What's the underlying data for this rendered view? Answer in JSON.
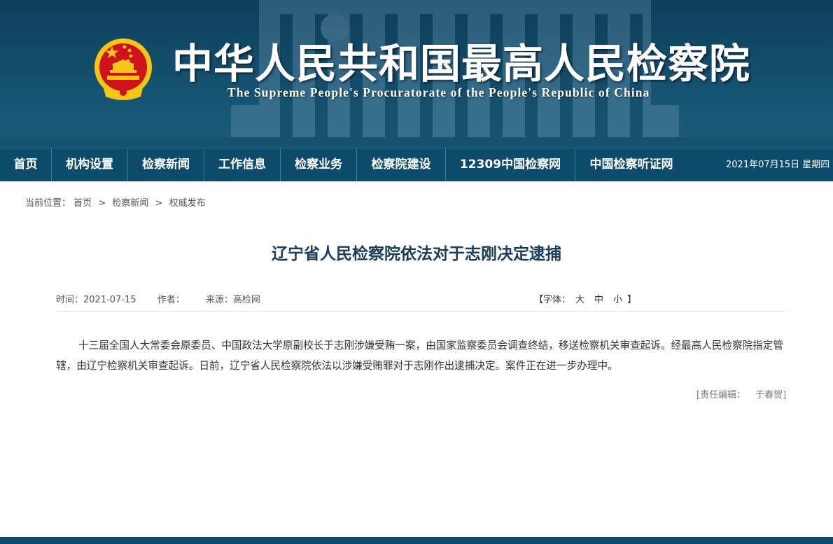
{
  "header": {
    "title_cn": "中华人民共和国最高人民检察院",
    "title_en": "The Supreme People's Procuratorate of the People's Republic of China",
    "emblem_icon": "national-emblem-icon",
    "colors": {
      "banner": "#124a68",
      "nav": "#0d4a6b",
      "emblem_red": "#d0121b",
      "emblem_gold": "#f5c518"
    }
  },
  "nav": {
    "items": [
      {
        "label": "首页"
      },
      {
        "label": "机构设置"
      },
      {
        "label": "检察新闻"
      },
      {
        "label": "工作信息"
      },
      {
        "label": "检察业务"
      },
      {
        "label": "检察院建设"
      },
      {
        "label": "12309中国检察网"
      },
      {
        "label": "中国检察听证网"
      }
    ],
    "date": "2021年07月15日  星期四"
  },
  "breadcrumb": {
    "prefix": "当前位置：",
    "items": [
      "首页",
      "检察新闻",
      "权威发布"
    ],
    "separator": ">"
  },
  "article": {
    "title": "辽宁省人民检察院依法对于志刚决定逮捕",
    "time": "时间：2021-07-15",
    "author": "作者：",
    "source": "来源：高检网",
    "font_size": {
      "open": "【字体：",
      "large": "大",
      "medium": "中",
      "small": "小",
      "close": "】"
    },
    "body": "十三届全国人大常委会原委员、中国政法大学原副校长于志刚涉嫌受贿一案，由国家监察委员会调查终结，移送检察机关审查起诉。经最高人民检察院指定管辖，由辽宁检察机关审查起诉。日前，辽宁省人民检察院依法以涉嫌受贿罪对于志刚作出逮捕决定。案件正在进一步办理中。",
    "editor_label": "[责任编辑：",
    "editor_name": "于春贺]"
  }
}
